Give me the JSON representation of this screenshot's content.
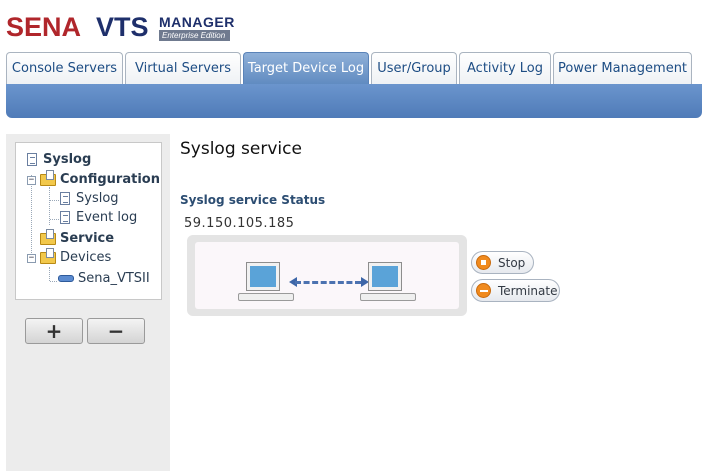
{
  "brand": {
    "company": "SENA",
    "product": "VTS",
    "manager": "MANAGER",
    "edition": "Enterprise Edition"
  },
  "tabs": [
    {
      "label": "Console Servers",
      "active": false
    },
    {
      "label": "Virtual Servers",
      "active": false
    },
    {
      "label": "Target Device Log",
      "active": true
    },
    {
      "label": "User/Group",
      "active": false
    },
    {
      "label": "Activity Log",
      "active": false
    },
    {
      "label": "Power Management",
      "active": false
    }
  ],
  "tree": {
    "root": "Syslog",
    "configuration": "Configuration",
    "config_syslog": "Syslog",
    "config_eventlog": "Event log",
    "service": "Service",
    "devices": "Devices",
    "device_item": "Sena_VTSII"
  },
  "sidebar_buttons": {
    "add": "+",
    "remove": "−"
  },
  "main": {
    "title": "Syslog service",
    "status_label": "Syslog service Status",
    "ip": "59.150.105.185",
    "stop_label": "Stop",
    "terminate_label": "Terminate"
  },
  "colors": {
    "brand_red": "#b0262b",
    "brand_navy": "#1e2f6b",
    "active_tab": "#6b95cd",
    "action_orange": "#f08a1e"
  }
}
